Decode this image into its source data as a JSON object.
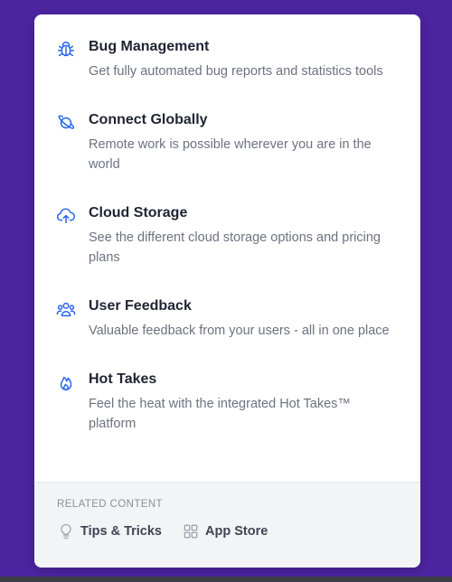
{
  "features": [
    {
      "icon": "bug-icon",
      "title": "Bug Management",
      "description": "Get fully automated bug reports and statistics tools"
    },
    {
      "icon": "globe-icon",
      "title": "Connect Globally",
      "description": "Remote work is possible wherever you are in the world"
    },
    {
      "icon": "cloud-upload-icon",
      "title": "Cloud Storage",
      "description": "See the different cloud storage options and pricing plans"
    },
    {
      "icon": "users-icon",
      "title": "User Feedback",
      "description": "Valuable feedback from your users - all in one place"
    },
    {
      "icon": "fire-icon",
      "title": "Hot Takes",
      "description": "Feel the heat with the integrated Hot Takes™ platform"
    }
  ],
  "related": {
    "heading": "RELATED CONTENT",
    "links": [
      {
        "icon": "lightbulb-icon",
        "label": "Tips & Tricks"
      },
      {
        "icon": "grid-icon",
        "label": "App Store"
      }
    ]
  },
  "colors": {
    "background": "#4c24a0",
    "accent": "#2563eb",
    "title": "#1f2433",
    "description": "#6b7280",
    "footer_bg": "#f3f4f6"
  }
}
